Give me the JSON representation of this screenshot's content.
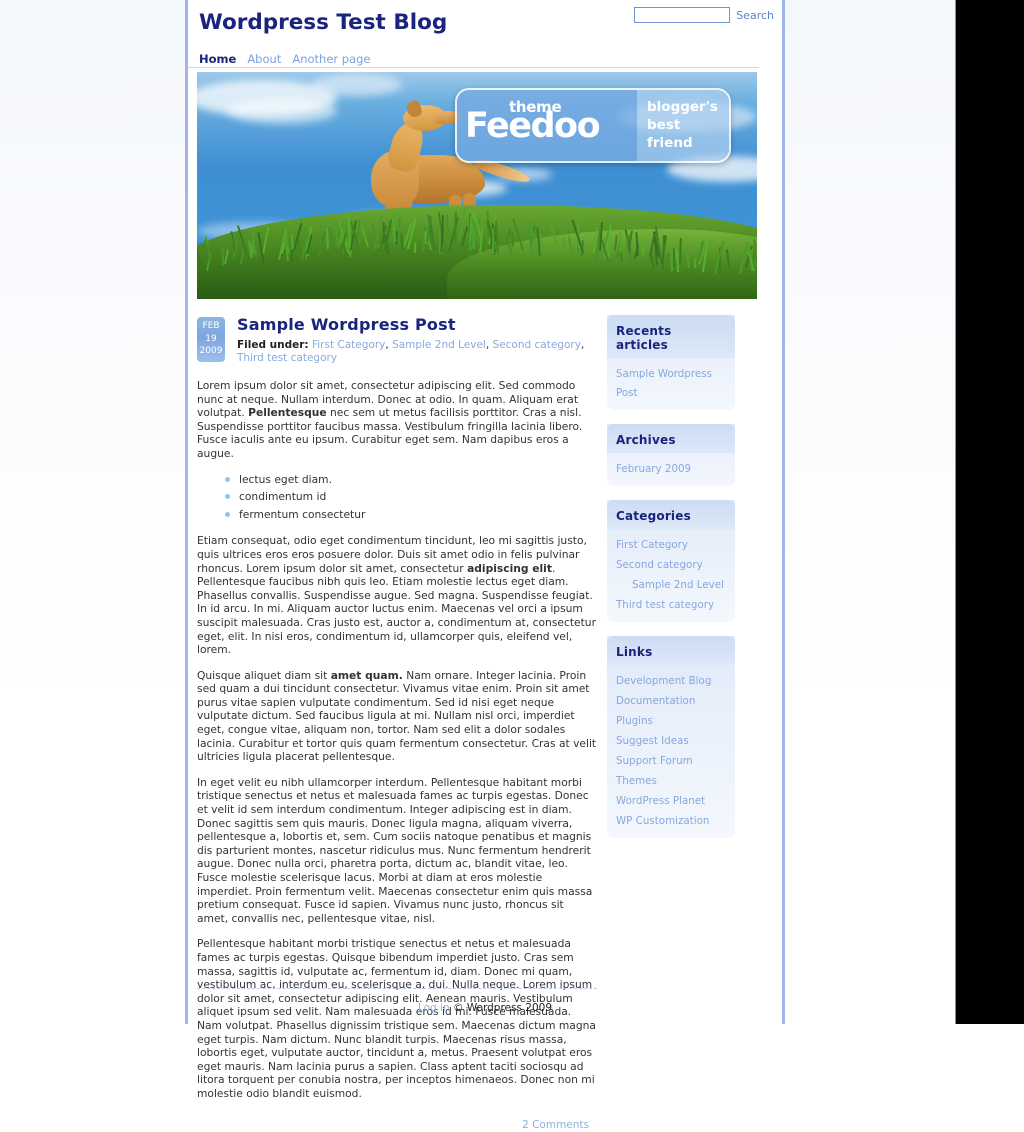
{
  "header": {
    "blog_title": "Wordpress Test Blog",
    "search": {
      "value": "",
      "placeholder": "",
      "label": "Search"
    }
  },
  "nav": {
    "items": [
      {
        "label": "Home",
        "active": true
      },
      {
        "label": "About",
        "active": false
      },
      {
        "label": "Another page",
        "active": false
      }
    ]
  },
  "banner": {
    "logo": {
      "theme_word": "theme",
      "brand": "Feedoo",
      "tagline": "blogger's\nbest\nfriend",
      "tag_line1": "blogger's",
      "tag_line2": "best",
      "tag_line3": "friend"
    }
  },
  "post": {
    "date": {
      "month": "FEB",
      "day": "19",
      "year": "2009"
    },
    "title": "Sample Wordpress Post",
    "filed_under_label": "Filed under:",
    "categories": [
      "First Category",
      "Sample 2nd Level",
      "Second category",
      "Third test category"
    ],
    "paragraphs": {
      "p1_a": "Lorem ipsum dolor sit amet, consectetur adipiscing elit. Sed commodo nunc at neque. Nullam interdum. Donec at odio. In quam. Aliquam erat volutpat. ",
      "p1_bold": "Pellentesque",
      "p1_b": " nec sem ut metus facilisis porttitor. Cras a nisl. Suspendisse porttitor faucibus massa. Vestibulum fringilla lacinia libero. Fusce iaculis ante eu ipsum. Curabitur eget sem. Nam dapibus eros a augue.",
      "p2_a": "Etiam consequat, odio eget condimentum tincidunt, leo mi sagittis justo, quis ultrices eros eros posuere dolor. Duis sit amet odio in felis pulvinar rhoncus. Lorem ipsum dolor sit amet, consectetur ",
      "p2_bold": "adipiscing elit",
      "p2_b": ". Pellentesque faucibus nibh quis leo. Etiam molestie lectus eget diam. Phasellus convallis. Suspendisse augue. Sed magna. Suspendisse feugiat. In id arcu. In mi. Aliquam auctor luctus enim. Maecenas vel orci a ipsum suscipit malesuada. Cras justo est, auctor a, condimentum at, consectetur eget, elit. In nisi eros, condimentum id, ullamcorper quis, eleifend vel, lorem.",
      "p3_a": "Quisque aliquet diam sit ",
      "p3_bold": "amet quam.",
      "p3_b": " Nam ornare. Integer lacinia. Proin sed quam a dui tincidunt consectetur. Vivamus vitae enim. Proin sit amet purus vitae sapien vulputate condimentum. Sed id nisi eget neque vulputate dictum. Sed faucibus ligula at mi. Nullam nisl orci, imperdiet eget, congue vitae, aliquam non, tortor. Nam sed elit a dolor sodales lacinia. Curabitur et tortor quis quam fermentum consectetur. Cras at velit ultricies ligula placerat pellentesque.",
      "p4": "In eget velit eu nibh ullamcorper interdum. Pellentesque habitant morbi tristique senectus et netus et malesuada fames ac turpis egestas. Donec et velit id sem interdum condimentum. Integer adipiscing est in diam. Donec sagittis sem quis mauris. Donec ligula magna, aliquam viverra, pellentesque a, lobortis et, sem. Cum sociis natoque penatibus et magnis dis parturient montes, nascetur ridiculus mus. Nunc fermentum hendrerit augue. Donec nulla orci, pharetra porta, dictum ac, blandit vitae, leo. Fusce molestie scelerisque lacus. Morbi at diam at eros molestie imperdiet. Proin fermentum velit. Maecenas consectetur enim quis massa pretium consequat. Fusce id sapien. Vivamus nunc justo, rhoncus sit amet, convallis nec, pellentesque vitae, nisl.",
      "p5": "Pellentesque habitant morbi tristique senectus et netus et malesuada fames ac turpis egestas. Quisque bibendum imperdiet justo. Cras sem massa, sagittis id, vulputate ac, fermentum id, diam. Donec mi quam, vestibulum ac, interdum eu, scelerisque a, dui. Nulla neque. Lorem ipsum dolor sit amet, consectetur adipiscing elit. Aenean mauris. Vestibulum aliquet ipsum sed velit. Nam malesuada eros id mi. Fusce malesuada. Nam volutpat. Phasellus dignissim tristique sem. Maecenas dictum magna eget turpis. Nam dictum. Nunc blandit turpis. Maecenas risus massa, lobortis eget, vulputate auctor, tincidunt a, metus. Praesent volutpat eros eget mauris. Nam lacinia purus a sapien. Class aptent taciti sociosqu ad litora torquent per conubia nostra, per inceptos himenaeos. Donec non mi molestie odio blandit euismod."
    },
    "list_items": [
      "lectus eget diam.",
      "condimentum id",
      "fermentum consectetur"
    ],
    "comments_link": "2 Comments"
  },
  "sidebar": {
    "widgets": [
      {
        "title": "Recents articles",
        "items": [
          {
            "label": "Sample Wordpress Post",
            "child": false
          }
        ]
      },
      {
        "title": "Archives",
        "items": [
          {
            "label": "February 2009",
            "child": false
          }
        ]
      },
      {
        "title": "Categories",
        "items": [
          {
            "label": "First Category",
            "child": false
          },
          {
            "label": "Second category",
            "child": false
          },
          {
            "label": "Sample 2nd Level",
            "child": true
          },
          {
            "label": "Third test category",
            "child": false
          }
        ]
      },
      {
        "title": "Links",
        "items": [
          {
            "label": "Development Blog",
            "child": false
          },
          {
            "label": "Documentation",
            "child": false
          },
          {
            "label": "Plugins",
            "child": false
          },
          {
            "label": "Suggest Ideas",
            "child": false
          },
          {
            "label": "Support Forum",
            "child": false
          },
          {
            "label": "Themes",
            "child": false
          },
          {
            "label": "WordPress Planet",
            "child": false
          },
          {
            "label": "WP Customization",
            "child": false
          }
        ]
      }
    ]
  },
  "footer": {
    "login_label": "Log in",
    "copyright": "© Wordpress 2009"
  },
  "colors": {
    "brand_dark_blue": "#1a237e",
    "link_blue": "#88a9dd",
    "border_blue": "#9fb8e8",
    "widget_bg": "#e3ecf9"
  }
}
